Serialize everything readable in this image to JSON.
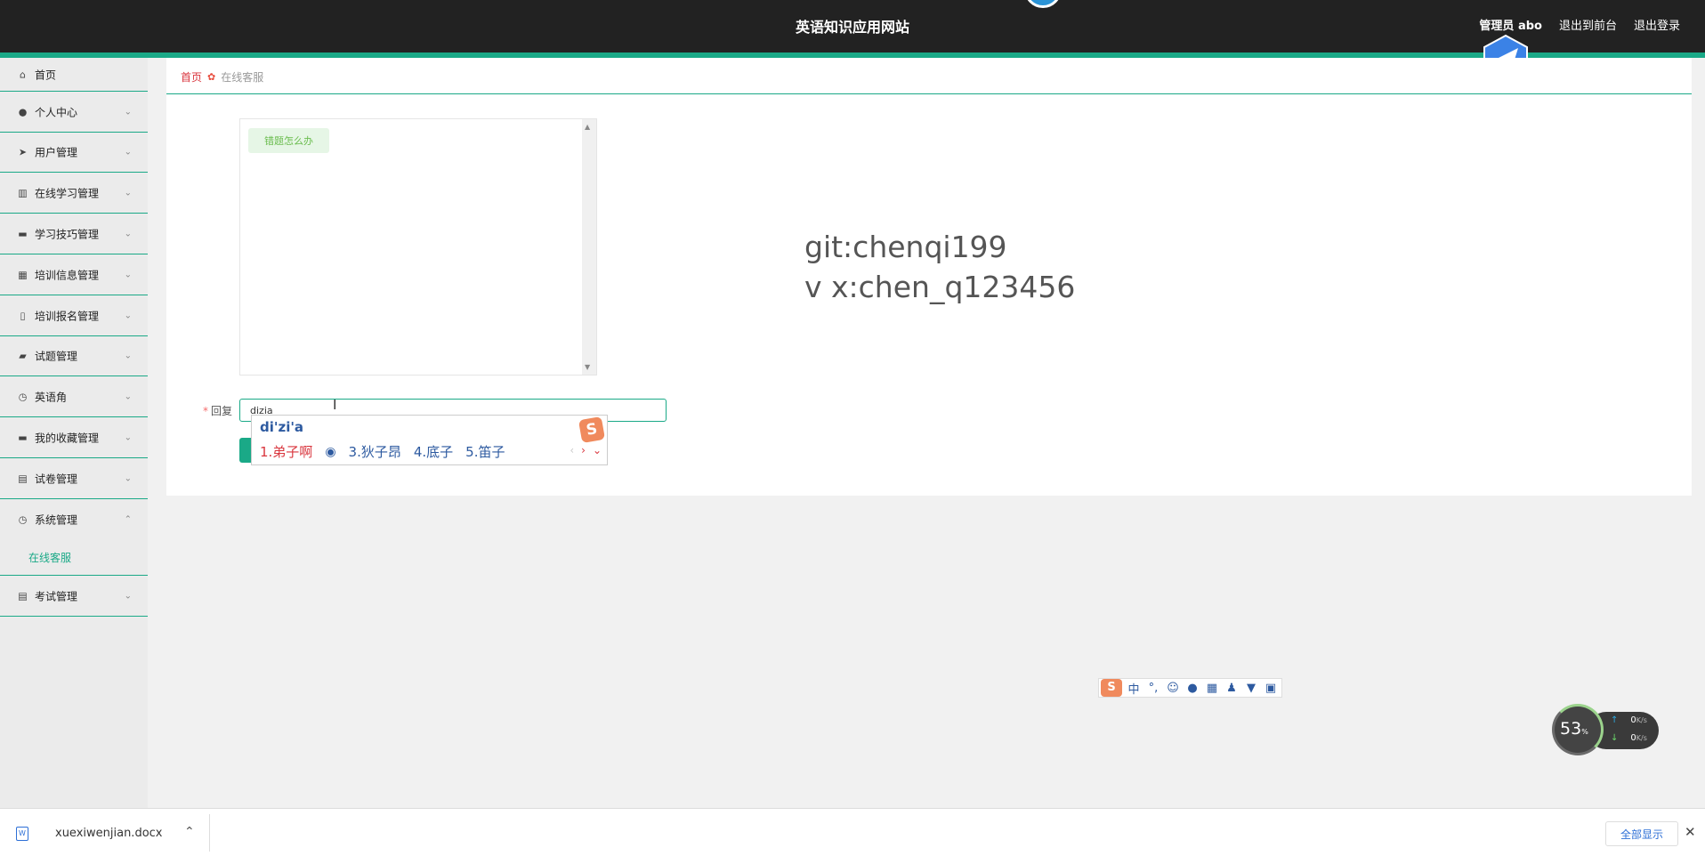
{
  "header": {
    "title": "英语知识应用网站",
    "admin": "管理员 abo",
    "to_front": "退出到前台",
    "logout": "退出登录"
  },
  "sidebar": {
    "items": [
      {
        "label": "首页",
        "icon": "home-icon",
        "glyph": "⌂"
      },
      {
        "label": "个人中心",
        "icon": "user-icon",
        "glyph": "●"
      },
      {
        "label": "用户管理",
        "icon": "send-icon",
        "glyph": "➤"
      },
      {
        "label": "在线学习管理",
        "icon": "books-icon",
        "glyph": "▥"
      },
      {
        "label": "学习技巧管理",
        "icon": "chat-icon",
        "glyph": "▬"
      },
      {
        "label": "培训信息管理",
        "icon": "grid-icon",
        "glyph": "▦"
      },
      {
        "label": "培训报名管理",
        "icon": "microphone-icon",
        "glyph": "▯"
      },
      {
        "label": "试题管理",
        "icon": "like-icon",
        "glyph": "▰"
      },
      {
        "label": "英语角",
        "icon": "compass-icon",
        "glyph": "◷"
      },
      {
        "label": "我的收藏管理",
        "icon": "comment-icon",
        "glyph": "▬"
      },
      {
        "label": "试卷管理",
        "icon": "clipboard-icon",
        "glyph": "▤"
      },
      {
        "label": "系统管理",
        "icon": "dashboard-icon",
        "glyph": "◷"
      },
      {
        "label": "考试管理",
        "icon": "clipboard-check-icon",
        "glyph": "▤"
      }
    ],
    "sub_item": "在线客服"
  },
  "breadcrumb": {
    "home": "首页",
    "current": "在线客服"
  },
  "chat": {
    "message": "错题怎么办"
  },
  "watermark": {
    "line1": "git:chenqi199",
    "line2": "v x:chen_q123456"
  },
  "reply": {
    "label": "回复",
    "value": "dizia"
  },
  "ime": {
    "pinyin": "di'zi'a",
    "candidates": [
      "1.弟子啊",
      "3.狄子昂",
      "4.底子",
      "5.笛子"
    ],
    "logo": "S"
  },
  "ime_toolbar": {
    "mode": "中"
  },
  "net_widget": {
    "percent": "53",
    "percent_unit": "%",
    "up": "0",
    "down": "0",
    "unit": "K/s"
  },
  "downloads": {
    "file": "xuexiwenjian.docx",
    "show_all": "全部显示"
  }
}
